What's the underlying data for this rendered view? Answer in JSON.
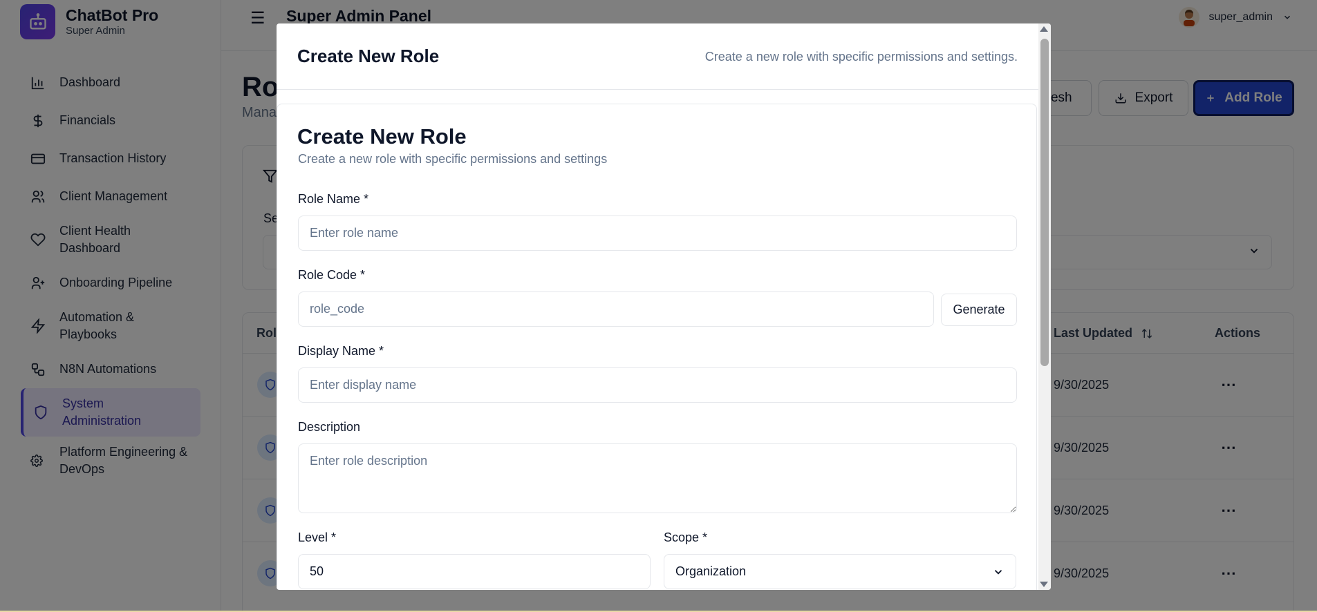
{
  "brand": {
    "title": "ChatBot Pro",
    "subtitle": "Super Admin"
  },
  "sidebar": {
    "items": [
      {
        "label": "Dashboard",
        "icon": "bar-chart-icon"
      },
      {
        "label": "Financials",
        "icon": "dollar-icon"
      },
      {
        "label": "Transaction History",
        "icon": "credit-card-icon"
      },
      {
        "label": "Client Management",
        "icon": "users-icon"
      },
      {
        "label": "Client Health Dashboard",
        "icon": "heart-icon"
      },
      {
        "label": "Onboarding Pipeline",
        "icon": "user-plus-icon"
      },
      {
        "label": "Automation & Playbooks",
        "icon": "lightning-icon"
      },
      {
        "label": "N8N Automations",
        "icon": "workflow-icon"
      },
      {
        "label": "System Administration",
        "icon": "shield-icon",
        "active": true
      },
      {
        "label": "Platform Engineering & DevOps",
        "icon": "gear-icon"
      }
    ]
  },
  "header": {
    "title": "Super Admin Panel",
    "user": "super_admin"
  },
  "page": {
    "title": "Rol",
    "subtitle": "Mana",
    "buttons": {
      "refresh": "fresh",
      "export": "Export",
      "add": "Add Role"
    },
    "filter_label": "Se",
    "table": {
      "col_role": "Rol",
      "col_updated": "Last Updated",
      "col_actions": "Actions",
      "rows": [
        {
          "date": "9/30/2025"
        },
        {
          "date": "9/30/2025"
        },
        {
          "date": "9/30/2025"
        },
        {
          "date": "9/30/2025"
        }
      ]
    }
  },
  "modal": {
    "title": "Create New Role",
    "description": "Create a new role with specific permissions and settings.",
    "form_title": "Create New Role",
    "form_subtitle": "Create a new role with specific permissions and settings",
    "fields": {
      "role_name": {
        "label": "Role Name *",
        "placeholder": "Enter role name"
      },
      "role_code": {
        "label": "Role Code *",
        "placeholder": "role_code",
        "generate": "Generate"
      },
      "display_name": {
        "label": "Display Name *",
        "placeholder": "Enter display name"
      },
      "description": {
        "label": "Description",
        "placeholder": "Enter role description"
      },
      "level": {
        "label": "Level *",
        "value": "50"
      },
      "scope": {
        "label": "Scope *",
        "value": "Organization"
      }
    }
  },
  "colors": {
    "accent": "#2547d0",
    "active_nav": "#ede9fe",
    "overlay": "rgba(0,0,0,0.5)"
  }
}
